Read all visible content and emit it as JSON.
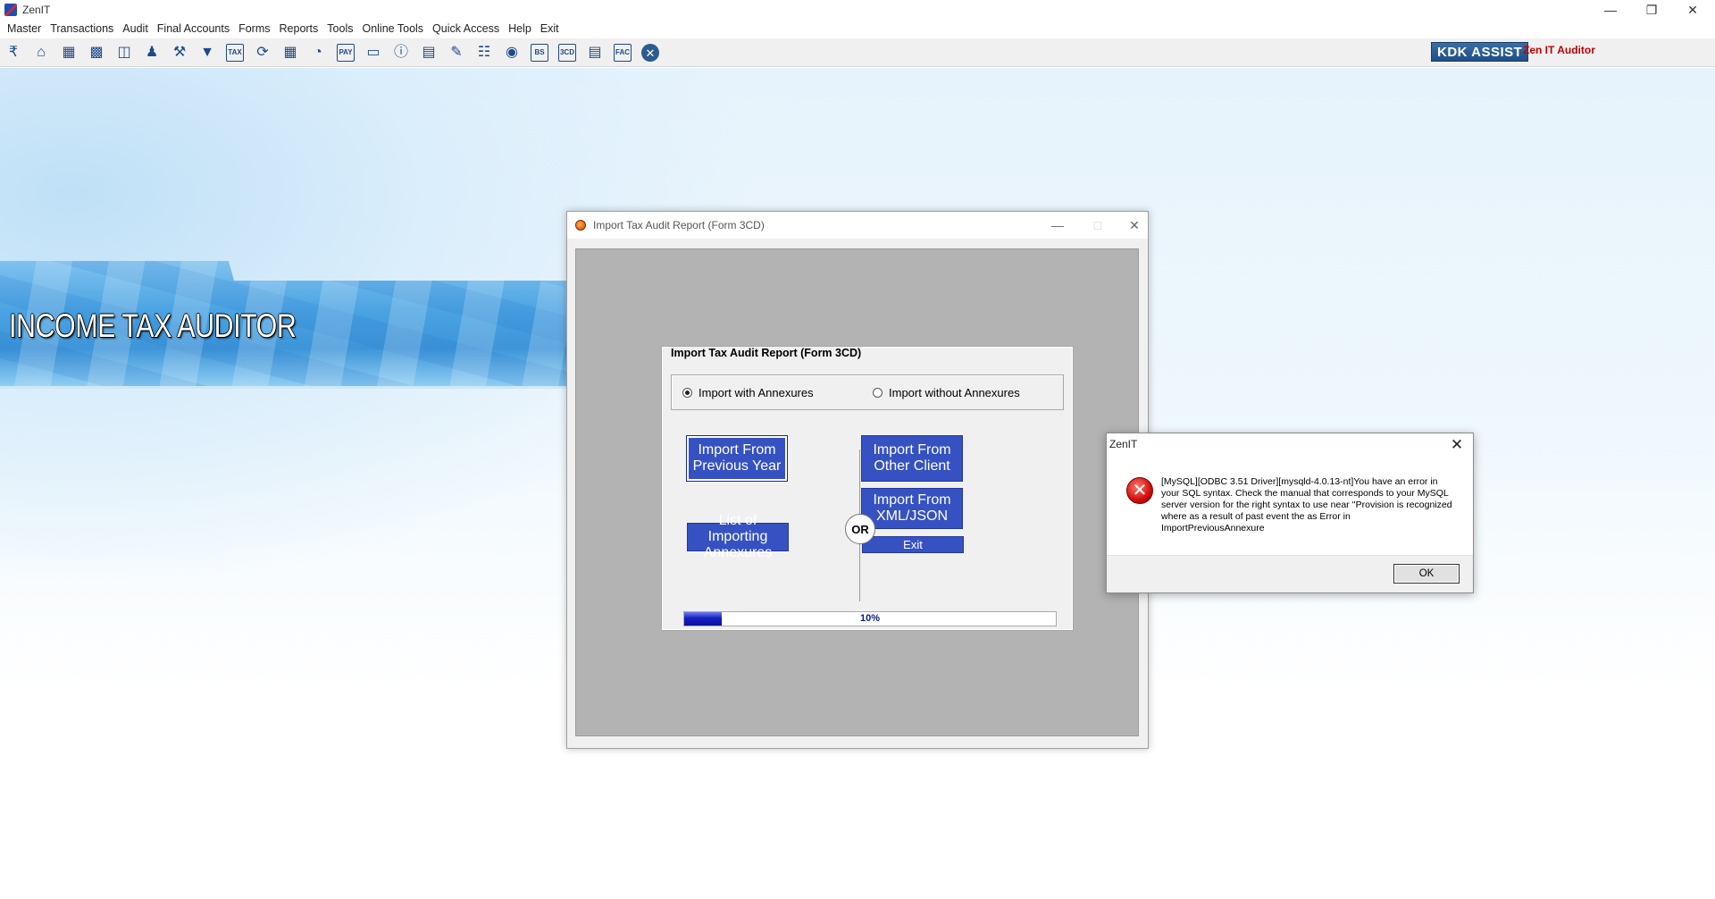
{
  "app": {
    "title": "ZenIT"
  },
  "menu": [
    "Master",
    "Transactions",
    "Audit",
    "Final Accounts",
    "Forms",
    "Reports",
    "Tools",
    "Online Tools",
    "Quick Access",
    "Help",
    "Exit"
  ],
  "toolbar": {
    "icons": [
      "rupee-icon",
      "home-icon",
      "building-icon",
      "bar-chart-icon",
      "gift-icon",
      "users-icon",
      "tools-icon",
      "filter-icon",
      "tax-icon",
      "refresh-icon",
      "calculator-icon",
      "pie-chart-icon",
      "pay-icon",
      "book-icon",
      "info-icon",
      "ledger-icon",
      "edit-doc-icon",
      "calendar-icon",
      "map-pin-icon",
      "bs-icon",
      "3cd-icon",
      "report-icon",
      "fac-icon",
      "close-circle-icon"
    ],
    "labels": {
      "tax": "TAX",
      "pay": "PAY",
      "bs": "BS",
      "3cd": "3CD",
      "fac": "FAC"
    },
    "kdk_assist": "KDK ASSIST",
    "zen_auditor": "Zen IT Auditor"
  },
  "banner": {
    "title": "INCOME TAX AUDITOR"
  },
  "import_window": {
    "title": "Import Tax Audit Report (Form 3CD)",
    "panel_title": "Import Tax Audit Report (Form 3CD)",
    "radio_with": "Import with Annexures",
    "radio_without": "Import without Annexures",
    "selected": "with",
    "btn_prev_year": "Import From Previous Year",
    "btn_other_client": "Import From Other Client",
    "btn_xml_json": "Import From XML/JSON",
    "btn_list_annexures": "List of Importing Annexures",
    "btn_exit": "Exit",
    "or_label": "OR",
    "progress": {
      "value": 10,
      "label": "10%"
    }
  },
  "error_dialog": {
    "title": "ZenIT",
    "message": "[MySQL][ODBC 3.51 Driver][mysqld-4.0.13-nt]You have an error in your SQL syntax.  Check the manual that corresponds to your MySQL server version for the right syntax to use near ''Provision is recognized where as a result of past event the as Error in ImportPreviousAnnexure",
    "ok_label": "OK"
  },
  "colors": {
    "button_blue": "#3652c2",
    "kdk_blue": "#2a5c8f",
    "auditor_red": "#c00000",
    "error_red": "#d10d0d"
  }
}
